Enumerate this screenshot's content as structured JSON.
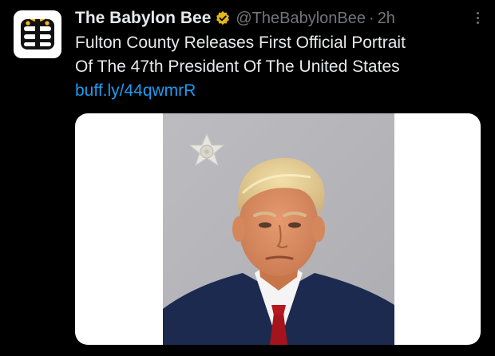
{
  "tweet": {
    "author": {
      "display_name": "The Babylon Bee",
      "handle": "@TheBabylonBee",
      "verified_icon": "verified-badge-icon",
      "avatar_icon": "babylon-bee-logo-icon"
    },
    "separator": "·",
    "timestamp": "2h",
    "more_icon": "more-options-icon",
    "text_lines": [
      "Fulton County Releases First Official Portrait",
      "Of The 47th President Of The United States"
    ],
    "link": "buff.ly/44qwmrR",
    "media": {
      "type": "photo"
    }
  },
  "colors": {
    "background": "#000000",
    "text_primary": "#e7e9ea",
    "text_secondary": "#71767b",
    "link": "#1d9bf0",
    "verified_gold": "#e2b719",
    "logo_yellow": "#f5b71b",
    "logo_black": "#111111"
  }
}
